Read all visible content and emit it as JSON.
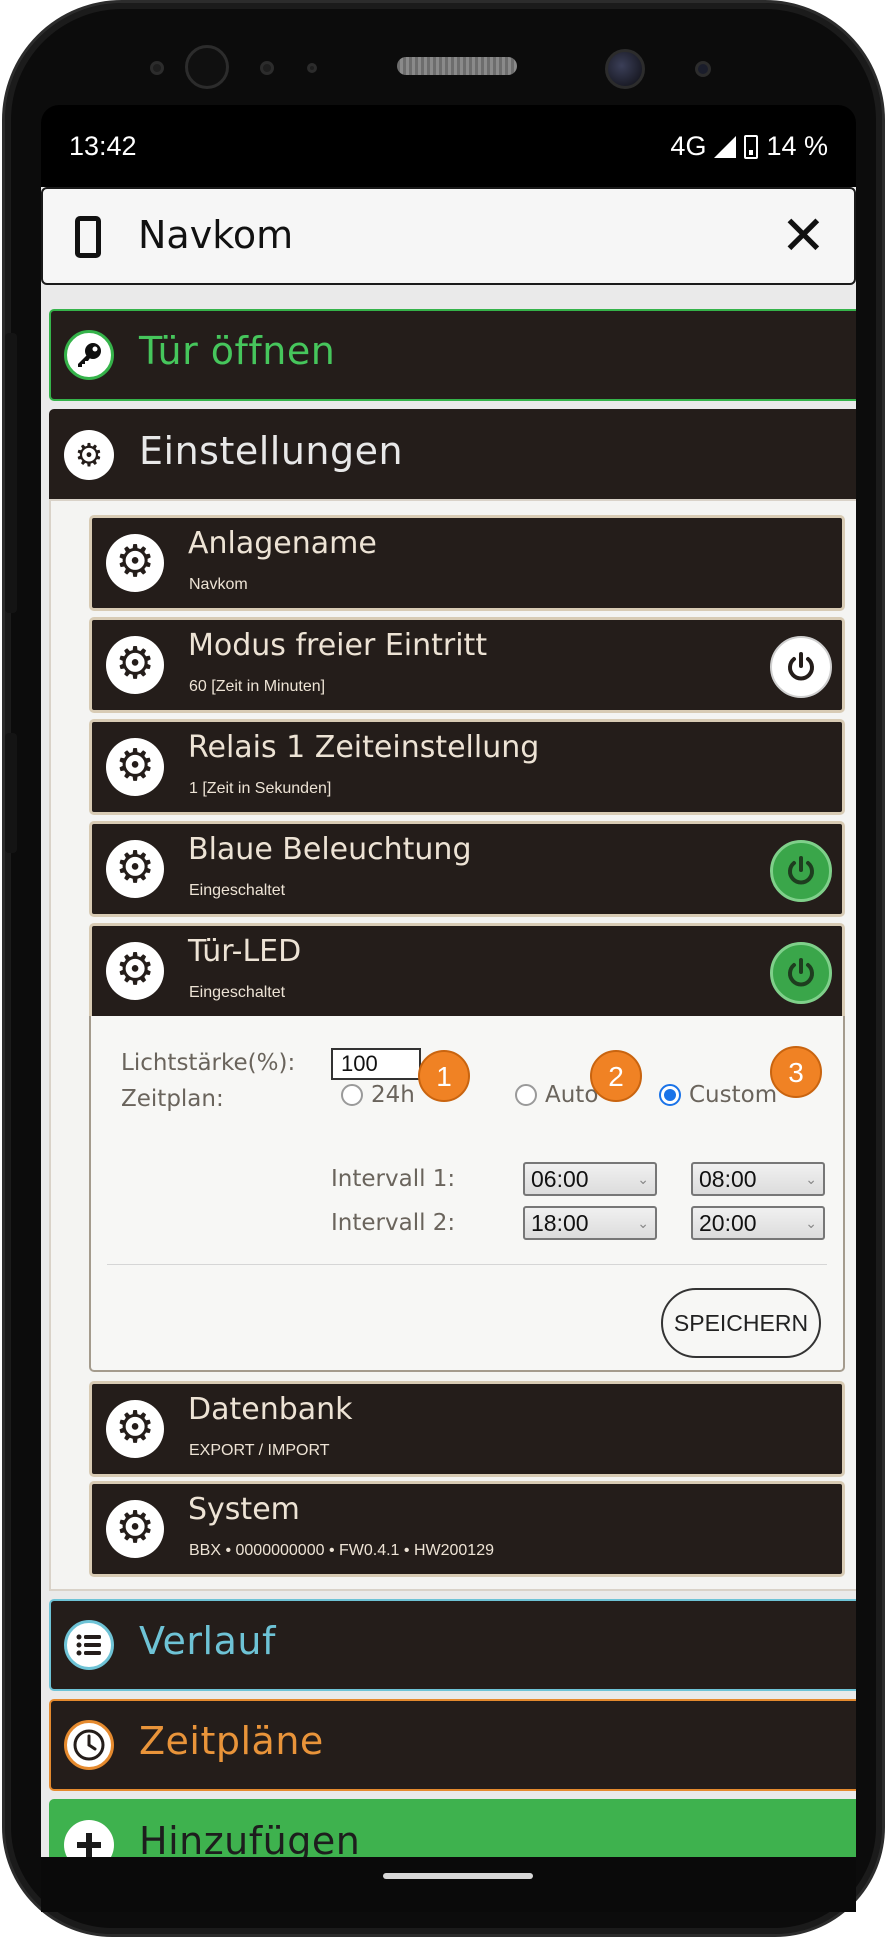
{
  "status_bar": {
    "time": "13:42",
    "network": "4G",
    "battery": "14 %"
  },
  "dialog": {
    "title": "Navkom",
    "close_icon": "close-icon"
  },
  "sections": {
    "door": {
      "label": "Tür öffnen",
      "icon": "key-icon",
      "color": "#46c65c"
    },
    "settings": {
      "label": "Einstellungen",
      "icon": "gear-icon"
    },
    "history": {
      "label": "Verlauf",
      "icon": "list-icon",
      "color": "#6ec3d6"
    },
    "schedules": {
      "label": "Zeitpläne",
      "icon": "clock-icon",
      "color": "#e9943a"
    },
    "add": {
      "label": "Hinzufügen",
      "icon": "plus-icon",
      "color": "#3eb24e"
    }
  },
  "settings_items": {
    "system_name": {
      "title": "Anlagename",
      "subtitle": "Navkom"
    },
    "free_entry": {
      "title": "Modus freier Eintritt",
      "subtitle": "60 [Zeit in Minuten]",
      "power": "off"
    },
    "relay": {
      "title": "Relais 1 Zeiteinstellung",
      "subtitle": "1 [Zeit in Sekunden]"
    },
    "blue_light": {
      "title": "Blaue Beleuchtung",
      "subtitle": "Eingeschaltet",
      "power": "on"
    },
    "door_led": {
      "title": "Tür-LED",
      "subtitle": "Eingeschaltet",
      "power": "on"
    },
    "database": {
      "title": "Datenbank",
      "subtitle": "EXPORT / IMPORT"
    },
    "system": {
      "title": "System",
      "subtitle": "BBX • 0000000000 • FW0.4.1 • HW200129"
    }
  },
  "led_form": {
    "brightness_label": "Lichtstärke(%):",
    "brightness_value": "100",
    "schedule_label": "Zeitplan:",
    "options": [
      "24h",
      "Auto",
      "Custom"
    ],
    "selected_option": "Custom",
    "interval1_label": "Intervall 1:",
    "interval1_from": "06:00",
    "interval1_to": "08:00",
    "interval2_label": "Intervall 2:",
    "interval2_from": "18:00",
    "interval2_to": "20:00",
    "save_label": "SPEICHERN"
  },
  "callouts": [
    "1",
    "2",
    "3"
  ],
  "colors": {
    "panel_dark": "#241d1a",
    "accent_green": "#3aa64a",
    "callout_orange": "#f08224",
    "radio_blue": "#1a73e8"
  }
}
